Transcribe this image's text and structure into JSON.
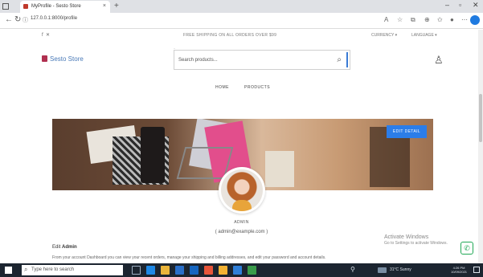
{
  "browser": {
    "tab_title": "MyProfile - Sesto Store",
    "tab_close": "×",
    "new_tab": "+",
    "url": "127.0.0.1:8000/profile",
    "min": "–",
    "max": "▫",
    "close": "✕"
  },
  "site": {
    "shipping_text": "FREE SHIPPING ON ALL ORDERS OVER $99",
    "currency": "CURRENCY ▾",
    "language": "LANGUAGE ▾",
    "logo_text": "Sesto Store",
    "search_placeholder": "Search products...",
    "nav": {
      "home": "HOME",
      "products": "PRODUCTS"
    },
    "edit_detail_button": "EDIT DETAIL",
    "role": "ADMIN",
    "email": "( admin@example.com )",
    "edit_label_prefix": "Edit",
    "edit_label_name": "Admin",
    "description": "From your account Dashboard you can view your recent orders, manage your shipping and billing addresses, and edit your password and account details."
  },
  "overlay": {
    "activate_title": "Activate Windows",
    "activate_sub": "Go to Settings to activate Windows."
  },
  "taskbar": {
    "search_placeholder": "Type here to search",
    "weather": "31°C Sunny",
    "time": "4:26 PM",
    "date": "10/09/2021"
  },
  "colors": {
    "accent": "#2b7de9",
    "logo": "#4a7ab8",
    "taskbar": "#1c2530",
    "whatsapp": "#1fa855"
  }
}
